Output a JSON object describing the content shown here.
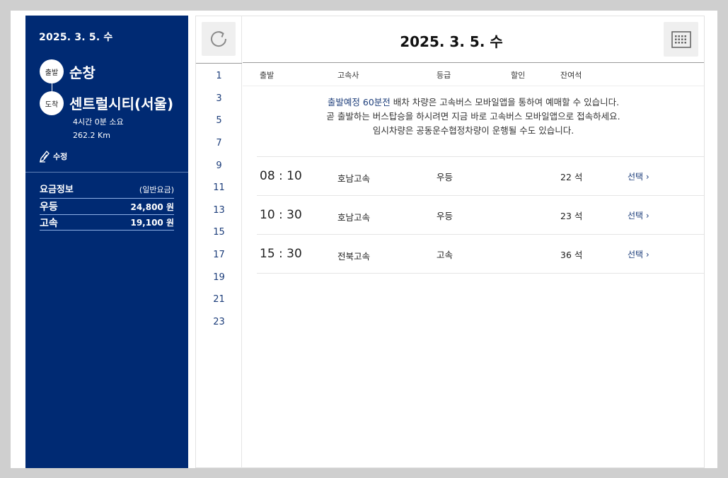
{
  "summary": {
    "date": "2025. 3. 5. 수",
    "departure_badge": "출발",
    "departure": "순창",
    "arrival_badge": "도착",
    "arrival": "센트럴시티(서울)",
    "duration": "4시간 0분 소요",
    "distance": "262.2 Km",
    "edit_label": "수정"
  },
  "fare": {
    "title": "요금정보",
    "subtitle": "(일반요금)",
    "rows": [
      {
        "grade": "우등",
        "price": "24,800 원"
      },
      {
        "grade": "고속",
        "price": "19,100 원"
      }
    ]
  },
  "header": {
    "date": "2025. 3. 5. 수",
    "refresh_icon": "refresh-icon",
    "calendar_icon": "calendar-icon"
  },
  "hours": [
    "1",
    "3",
    "5",
    "7",
    "9",
    "11",
    "13",
    "15",
    "17",
    "19",
    "21",
    "23"
  ],
  "columns": {
    "departure": "출발",
    "company": "고속사",
    "grade": "등급",
    "discount": "할인",
    "seats": "잔여석"
  },
  "notice": {
    "highlight": "출발예정 60분전",
    "line1_rest": " 배차 차량은 고속버스 모바일앱을 통하여 예매할 수 있습니다.",
    "line2": "곧 출발하는 버스탑승을 하시려면 지금 바로 고속버스 모바일앱으로 접속하세요.",
    "line3": "임시차량은 공동운수협정차량이 운행될 수도 있습니다."
  },
  "schedules": [
    {
      "time": "08 : 10",
      "company": "호남고속",
      "grade": "우등",
      "seats": "22 석",
      "select": "선택"
    },
    {
      "time": "10 : 30",
      "company": "호남고속",
      "grade": "우등",
      "seats": "23 석",
      "select": "선택"
    },
    {
      "time": "15 : 30",
      "company": "전북고속",
      "grade": "고속",
      "seats": "36 석",
      "select": "선택"
    }
  ],
  "colors": {
    "navy": "#002a73",
    "link": "#1c3d7a"
  }
}
